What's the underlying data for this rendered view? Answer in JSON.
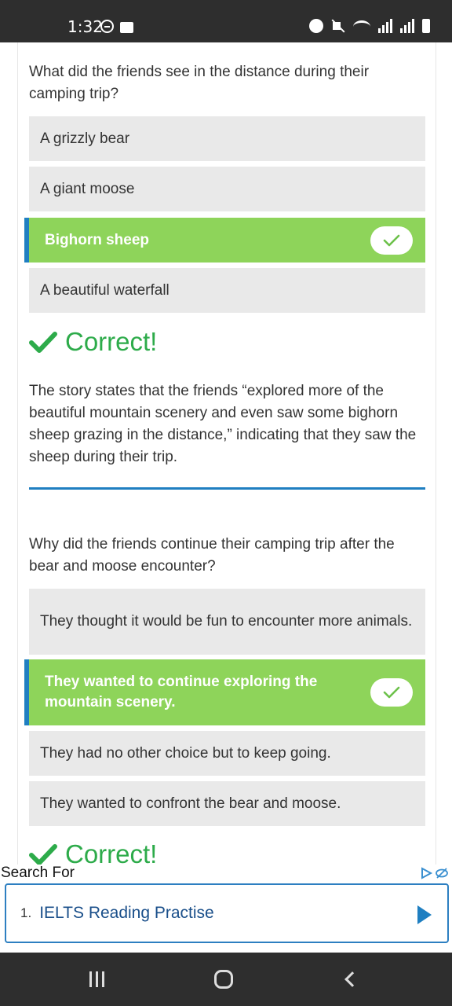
{
  "status_bar": {
    "time": "1:32",
    "icons": [
      "circle-minus-icon",
      "folder-icon",
      "alarm-icon",
      "mute-icon",
      "wifi-icon",
      "signal-icon",
      "signal-icon",
      "battery-icon"
    ]
  },
  "quiz": {
    "q1": {
      "question": "What did the friends see in the distance during their camping trip?",
      "options": [
        "A grizzly bear",
        "A giant moose",
        "Bighorn sheep",
        "A beautiful waterfall"
      ],
      "selected_index": 2,
      "result": "Correct!",
      "explanation": "The story states that the friends “explored more of the beautiful mountain scenery and even saw some bighorn sheep grazing in the distance,” indicating that they saw the sheep during their trip."
    },
    "q2": {
      "question": "Why did the friends continue their camping trip after the bear and moose encounter?",
      "options": [
        "They thought it would be fun to encounter more animals.",
        "They wanted to continue exploring the mountain scenery.",
        "They had no other choice but to keep going.",
        "They wanted to confront the bear and moose."
      ],
      "selected_index": 1,
      "result": "Correct!"
    }
  },
  "ad": {
    "label": "Search For",
    "item_number": "1.",
    "item_text": "IELTS Reading Practise"
  },
  "colors": {
    "selected_bg": "#8ed45a",
    "selected_border": "#1f7fc1",
    "option_bg": "#e9e9e9",
    "correct_green": "#2dab4a",
    "divider": "#1f7fc1"
  }
}
